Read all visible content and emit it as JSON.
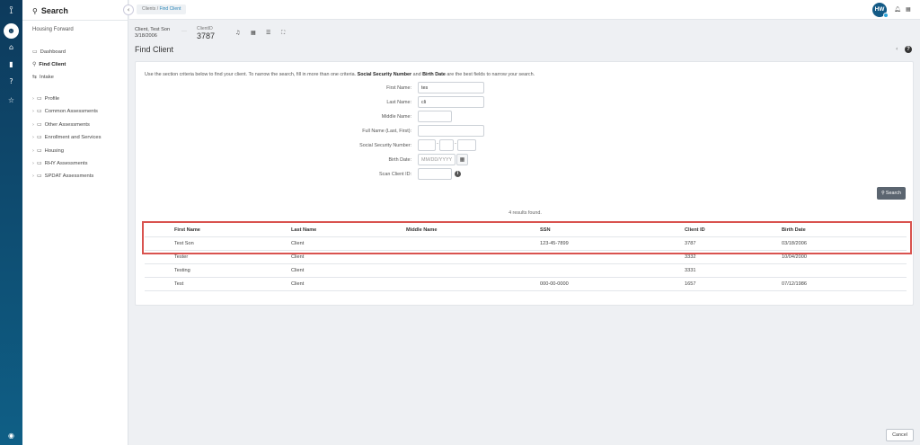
{
  "breadcrumb": {
    "parent": "Clients",
    "current": "Find Client"
  },
  "sidebar": {
    "title": "Search",
    "org": "Housing Forward",
    "links": [
      {
        "label": "Dashboard",
        "icon": "map-icon"
      },
      {
        "label": "Find Client",
        "icon": "search-icon"
      },
      {
        "label": "Intake",
        "icon": "swap-icon"
      }
    ],
    "folders": [
      "Profile",
      "Common Assessments",
      "Other Assessments",
      "Enrollment and Services",
      "Housing",
      "RHY Assessments",
      "SPDAT Assessments"
    ]
  },
  "user": {
    "initials": "HW"
  },
  "client": {
    "name_line1": "Client, Test Son",
    "dob": "3/18/2006",
    "id_label": "ClientID",
    "id": "3787",
    "dots": "···"
  },
  "page": {
    "title": "Find Client"
  },
  "form": {
    "instructions_pre": "Use the section criteria below to find your client. To narrow the search, fill in more than one criteria. ",
    "instructions_ssn": "Social Security Number",
    "instructions_mid": " and ",
    "instructions_bd": "Birth Date",
    "instructions_post": " are the best fields to narrow your search.",
    "first_name_label": "First Name:",
    "first_name_value": "tes",
    "last_name_label": "Last Name:",
    "last_name_value": "cli",
    "middle_name_label": "Middle Name:",
    "full_name_label": "Full Name (Last, First):",
    "ssn_label": "Social Security Number:",
    "ssn_sep": "-",
    "birth_date_label": "Birth Date:",
    "birth_date_placeholder": "MM/DD/YYYY",
    "scan_label": "Scan Client ID:",
    "search_label": "Search",
    "info": "i"
  },
  "results": {
    "count_text": "4 results found.",
    "columns": [
      "First Name",
      "Last Name",
      "Middle Name",
      "SSN",
      "Client ID",
      "Birth Date"
    ],
    "rows": [
      [
        "Test Son",
        "Client",
        "",
        "123-45-7899",
        "3787",
        "03/18/2006"
      ],
      [
        "Tester",
        "Client",
        "",
        "",
        "3332",
        "10/04/2000"
      ],
      [
        "Testing",
        "Client",
        "",
        "",
        "3331",
        ""
      ],
      [
        "Test",
        "Client",
        "",
        "000-00-0000",
        "1657",
        "07/12/1986"
      ]
    ]
  },
  "footer": {
    "cancel_label": "Cancel"
  },
  "colors": {
    "rail": "#0d3a5c",
    "accent": "#2a86b8",
    "highlight": "#d9534f",
    "search_button": "#5b6570"
  }
}
